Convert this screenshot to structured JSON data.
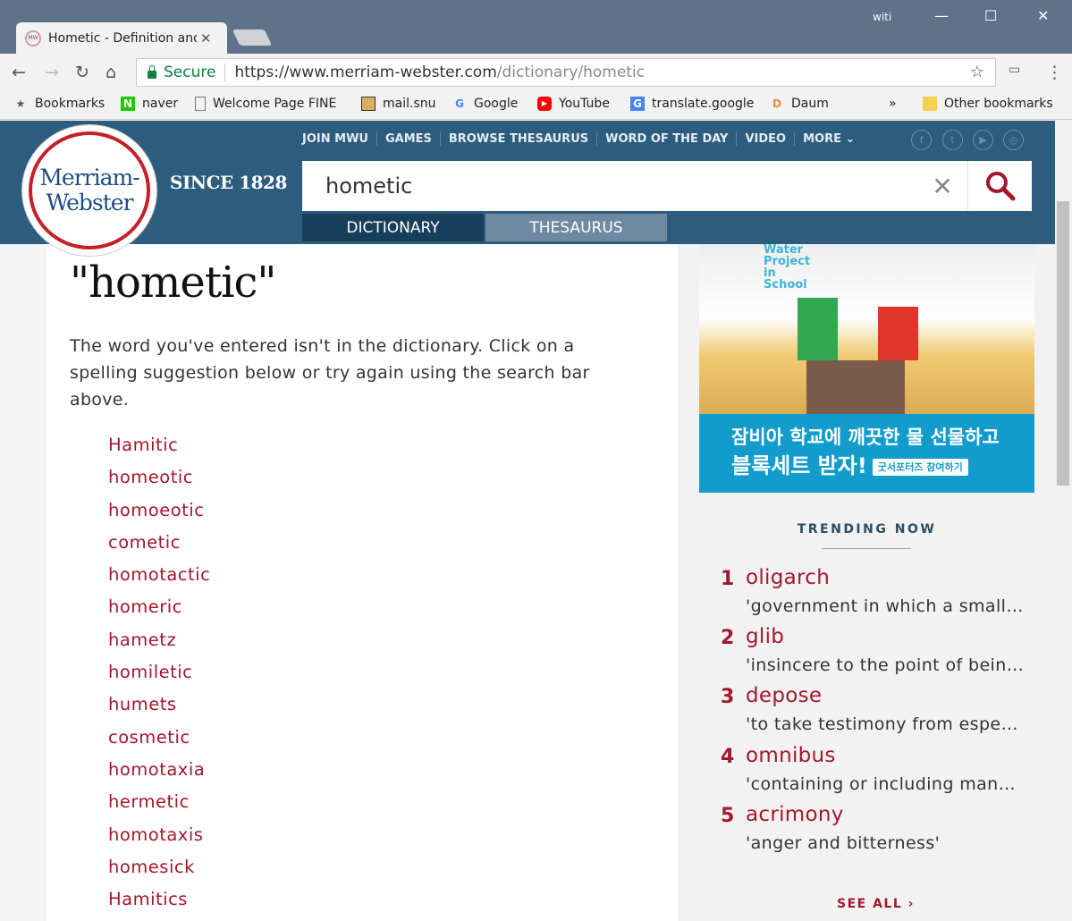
{
  "browser": {
    "tab_title": "Hometic - Definition and",
    "favicon": "MW",
    "user": "witi",
    "secure_label": "Secure",
    "url_host": "https://www.merriam-webster.com",
    "url_path": "/dictionary/hometic",
    "bookmarks": [
      {
        "label": "Bookmarks",
        "icon": "star-icon"
      },
      {
        "label": "naver",
        "icon": "naver-icon"
      },
      {
        "label": "Welcome Page FINE",
        "icon": "page-icon"
      },
      {
        "label": "mail.snu",
        "icon": "image-icon"
      },
      {
        "label": "Google",
        "icon": "google-icon"
      },
      {
        "label": "YouTube",
        "icon": "youtube-icon"
      },
      {
        "label": "translate.google",
        "icon": "translate-icon"
      },
      {
        "label": "Daum",
        "icon": "daum-icon"
      }
    ],
    "overflow": "»",
    "other_bookmarks": "Other bookmarks"
  },
  "header": {
    "logo_line1": "Merriam-",
    "logo_line2": "Webster",
    "since": "SINCE 1828",
    "nav": [
      "JOIN MWU",
      "GAMES",
      "BROWSE THESAURUS",
      "WORD OF THE DAY",
      "VIDEO",
      "MORE ⌄"
    ],
    "social": [
      "f",
      "t",
      "▶",
      "◎"
    ],
    "search_value": "hometic",
    "tab_dictionary": "DICTIONARY",
    "tab_thesaurus": "THESAURUS"
  },
  "main": {
    "title": "\"hometic\"",
    "message": "The word you've entered isn't in the dictionary. Click on a spelling suggestion below or try again using the search bar above.",
    "suggestions": [
      "Hamitic",
      "homeotic",
      "homoeotic",
      "cometic",
      "homotactic",
      "homeric",
      "hametz",
      "homiletic",
      "humets",
      "cosmetic",
      "homotaxia",
      "hermetic",
      "homotaxis",
      "homesick",
      "Hamitics"
    ]
  },
  "ad": {
    "logo": "Water Project in School",
    "line1": "잠비아 학교에 깨끗한 물 선물하고",
    "line2": "블록세트 받자!",
    "button": "굿서포터즈 참여하기"
  },
  "trending": {
    "heading": "TRENDING NOW",
    "items": [
      {
        "rank": "1",
        "word": "oligarch",
        "def": "'government in which a small group exercises control'"
      },
      {
        "rank": "2",
        "word": "glib",
        "def": "'insincere to the point of being deceitful'"
      },
      {
        "rank": "3",
        "word": "depose",
        "def": "'to take testimony from especially by deposition'"
      },
      {
        "rank": "4",
        "word": "omnibus",
        "def": "'containing or including many items'"
      },
      {
        "rank": "5",
        "word": "acrimony",
        "def": "'anger and bitterness'"
      }
    ],
    "see_all": "SEE ALL ›"
  },
  "colors": {
    "brand_blue": "#2c5c7e",
    "link_red": "#a3172d"
  }
}
